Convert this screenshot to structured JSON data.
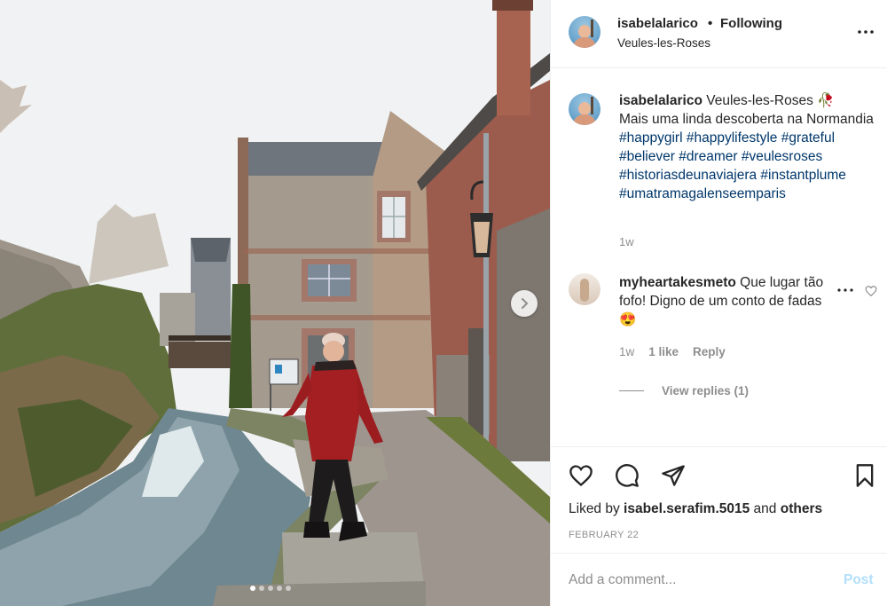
{
  "post": {
    "username": "isabelalarico",
    "separator": "•",
    "follow_status": "Following",
    "location": "Veules-les-Roses",
    "icons": {
      "more": "more-horizontal-icon",
      "next": "chevron-right-icon",
      "like": "heart-icon",
      "comment": "comment-bubble-icon",
      "share": "paper-plane-icon",
      "save": "bookmark-icon"
    },
    "photo": {
      "carousel_count": 5,
      "active_index": 0
    }
  },
  "caption": {
    "username": "isabelalarico",
    "text": "Veules-les-Roses 🥀",
    "line2": "Mais uma linda descoberta na Normandia",
    "hashtags": [
      "#happygirl",
      "#happylifestyle",
      "#grateful",
      "#believer",
      "#dreamer",
      "#veulesroses",
      "#historiasdeunaviajera",
      "#instantplume",
      "#umatramagalenseemparis"
    ],
    "time": "1w"
  },
  "comment": {
    "username": "myheartakesmeto",
    "text": "Que lugar tão fofo! Digno de um conto de fadas 😍",
    "time": "1w",
    "likes": "1 like",
    "reply_label": "Reply",
    "view_replies": "View replies (1)"
  },
  "likes": {
    "prefix": "Liked by",
    "user": "isabel.serafim.5015",
    "conj": "and",
    "others": "others"
  },
  "date": "FEBRUARY 22",
  "add_comment": {
    "placeholder": "Add a comment...",
    "post_label": "Post"
  }
}
